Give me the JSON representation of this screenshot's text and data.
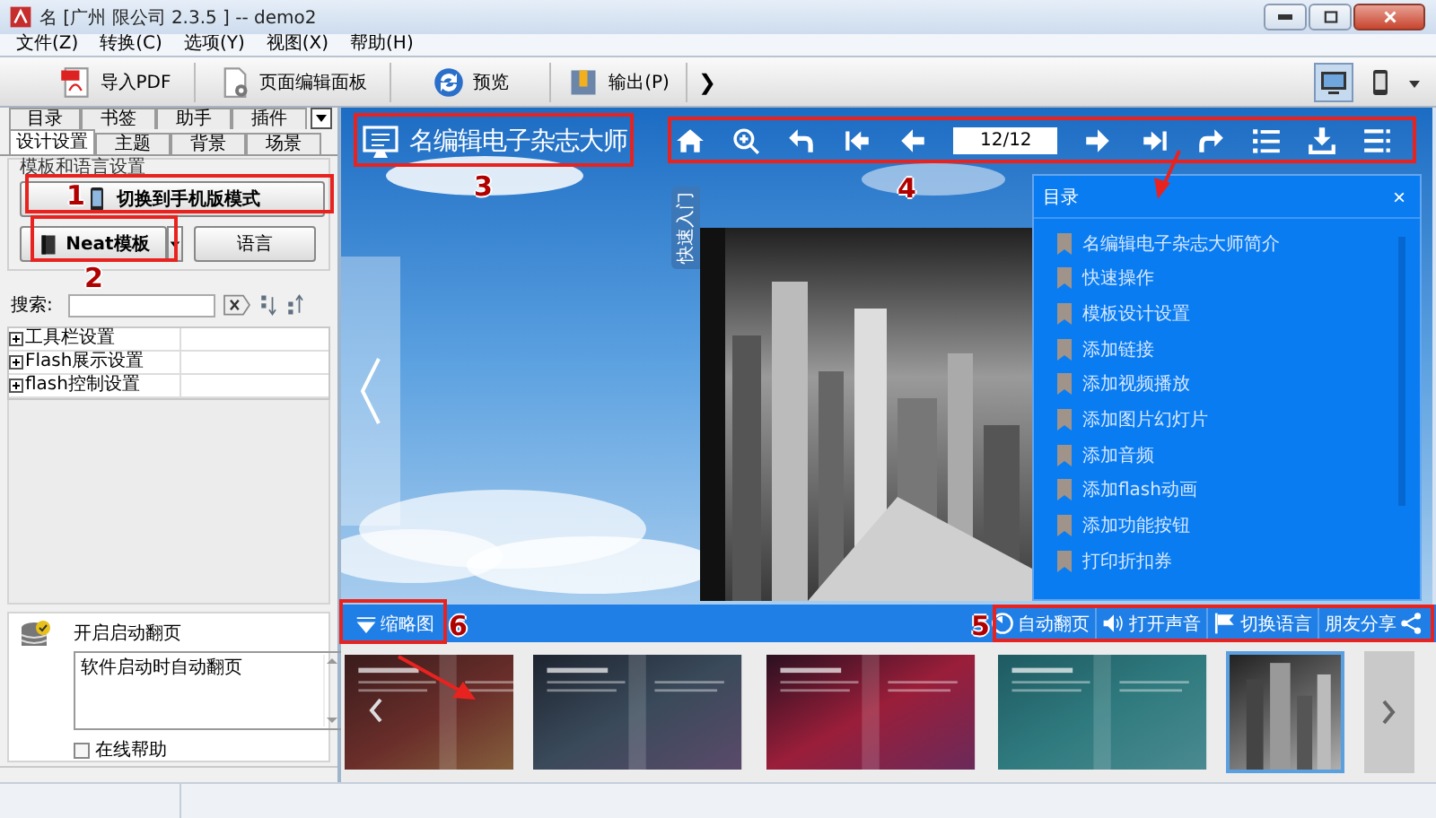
{
  "window": {
    "title": "名 [广州 限公司 2.3.5 ] -- demo2"
  },
  "menu": [
    "文件(Z)",
    "转换(C)",
    "选项(Y)",
    "视图(X)",
    "帮助(H)"
  ],
  "toolbar": [
    {
      "kind": "pdf",
      "label": "导入PDF"
    },
    {
      "kind": "editor",
      "label": "页面编辑面板"
    },
    {
      "kind": "preview",
      "label": "预览"
    },
    {
      "kind": "output",
      "label": "输出(P)"
    },
    {
      "kind": "more",
      "label": "❯"
    }
  ],
  "device_buttons": [
    {
      "kind": "desktop",
      "selected": true
    },
    {
      "kind": "phone",
      "selected": false
    }
  ],
  "side_tabs": {
    "row_1": [
      {
        "label": "目录",
        "selected": false
      },
      {
        "label": "书签",
        "selected": false
      },
      {
        "label": "助手",
        "selected": false
      },
      {
        "label": "插件",
        "selected": false
      }
    ],
    "row_2": [
      {
        "label": "设计设置",
        "selected": true
      },
      {
        "label": "主题",
        "selected": false
      },
      {
        "label": "背景",
        "selected": false
      },
      {
        "label": "场景",
        "selected": false
      }
    ]
  },
  "template_group": {
    "title": "模板和语言设置",
    "mobile_button": "切换到手机版模式",
    "template_button": "Neat模板",
    "language_button": "语言"
  },
  "search": {
    "label": "搜索:"
  },
  "properties": [
    {
      "label": "工具栏设置",
      "expanded": false
    },
    {
      "label": "Flash展示设置",
      "expanded": false
    },
    {
      "label": "flash控制设置",
      "expanded": false
    }
  ],
  "help_panel": {
    "title": "开启启动翻页",
    "description": "软件启动时自动翻页",
    "online_help": {
      "label": "在线帮助",
      "checked": false
    }
  },
  "viewer": {
    "logo": "名编辑电子杂志大师",
    "page_field": "12/12",
    "side_tab": "快速入门",
    "toc": {
      "title": "目录",
      "close": "×",
      "items": [
        "名编辑电子杂志大师简介",
        "快速操作",
        "模板设计设置",
        "添加链接",
        "添加视频播放",
        "添加图片幻灯片",
        "添加音频",
        "添加flash动画",
        "添加功能按钮",
        "打印折扣券"
      ]
    },
    "thumbnail_label": "缩略图",
    "actions": [
      {
        "kind": "auto",
        "label": "自动翻页"
      },
      {
        "kind": "sound",
        "label": "打开声音"
      },
      {
        "kind": "language",
        "label": "切换语言"
      },
      {
        "kind": "share",
        "label": "朋友分享"
      }
    ],
    "thumbnails": [
      {
        "selected": false
      },
      {
        "selected": false
      },
      {
        "selected": false
      },
      {
        "selected": false
      },
      {
        "selected": true
      }
    ]
  },
  "annotations": [
    {
      "label": "1"
    },
    {
      "label": "2"
    },
    {
      "label": "3"
    },
    {
      "label": "4"
    },
    {
      "label": "5"
    },
    {
      "label": "6"
    }
  ]
}
